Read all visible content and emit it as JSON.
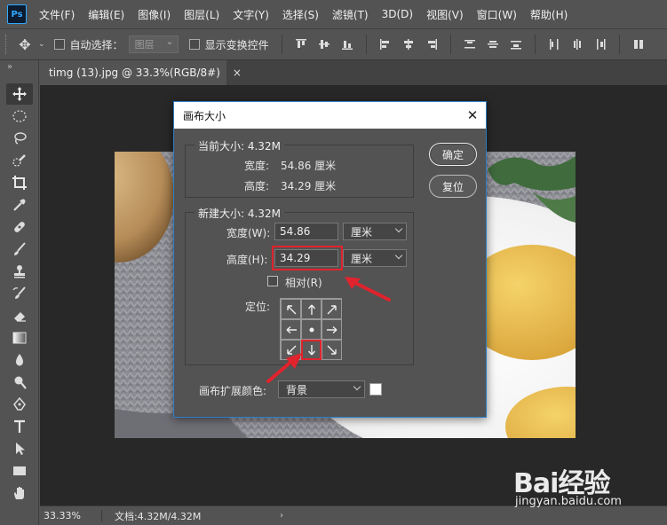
{
  "app": {
    "logo": "Ps"
  },
  "menu": [
    "文件(F)",
    "编辑(E)",
    "图像(I)",
    "图层(L)",
    "文字(Y)",
    "选择(S)",
    "滤镜(T)",
    "3D(D)",
    "视图(V)",
    "窗口(W)",
    "帮助(H)"
  ],
  "options": {
    "auto_select": "自动选择：",
    "auto_select_target": "图层",
    "show_transform": "显示变换控件"
  },
  "toolbar": {
    "collapse": "»"
  },
  "document": {
    "tab_title": "timg (13).jpg @ 33.3%(RGB/8#)",
    "close": "×"
  },
  "status": {
    "zoom": "33.33%",
    "doc": "文档:4.32M/4.32M",
    "arrow": "›"
  },
  "dialog": {
    "title": "画布大小",
    "close": "✕",
    "current": {
      "label": "当前大小: 4.32M",
      "width_label": "宽度:",
      "width_value": "54.86 厘米",
      "height_label": "高度:",
      "height_value": "34.29 厘米"
    },
    "new": {
      "label": "新建大小: 4.32M",
      "width_label": "宽度(W):",
      "width_value": "54.86",
      "width_unit": "厘米",
      "height_label": "高度(H):",
      "height_value": "34.29",
      "height_unit": "厘米",
      "relative": "相对(R)",
      "anchor_label": "定位:"
    },
    "ok": "确定",
    "reset": "复位",
    "extension_label": "画布扩展颜色:",
    "extension_value": "背景"
  },
  "watermark": {
    "brand": "Bai经验",
    "sub": "jingyan.baidu.com"
  },
  "colors": {
    "highlight": "#e0232d",
    "dialog_border": "#2b7ec9",
    "ps_blue": "#31a8ff"
  }
}
